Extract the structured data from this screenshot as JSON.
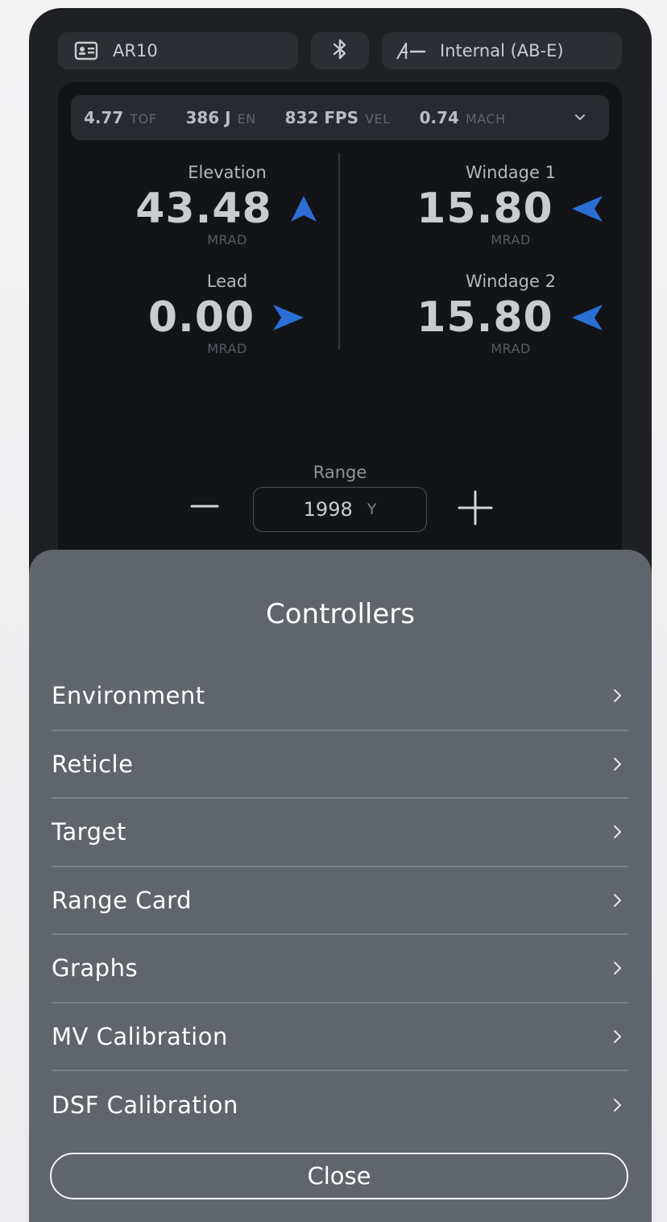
{
  "header": {
    "profile_name": "AR10",
    "source_label": "Internal (AB-E)"
  },
  "stats": [
    {
      "value": "4.77",
      "unit": "TOF"
    },
    {
      "value": "386 J",
      "unit": "EN"
    },
    {
      "value": "832 FPS",
      "unit": "VEL"
    },
    {
      "value": "0.74",
      "unit": "MACH"
    }
  ],
  "solution": {
    "elevation": {
      "label": "Elevation",
      "value": "43.48",
      "unit": "MRAD",
      "direction": "up"
    },
    "windage1": {
      "label": "Windage 1",
      "value": "15.80",
      "unit": "MRAD",
      "direction": "left"
    },
    "lead": {
      "label": "Lead",
      "value": "0.00",
      "unit": "MRAD",
      "direction": "right"
    },
    "windage2": {
      "label": "Windage 2",
      "value": "15.80",
      "unit": "MRAD",
      "direction": "left"
    }
  },
  "range": {
    "label": "Range",
    "value": "1998",
    "unit": "Y"
  },
  "sheet": {
    "title": "Controllers",
    "items": [
      {
        "label": "Environment"
      },
      {
        "label": "Reticle"
      },
      {
        "label": "Target"
      },
      {
        "label": "Range Card"
      },
      {
        "label": "Graphs"
      },
      {
        "label": "MV Calibration"
      },
      {
        "label": "DSF Calibration"
      }
    ],
    "close_label": "Close"
  },
  "colors": {
    "accent_arrow": "#2b6fd6",
    "sheet_bg": "#60646b",
    "panel_bg": "#121418"
  },
  "icons": {
    "profile": "id-card-icon",
    "bluetooth": "bluetooth-icon",
    "source": "ab-logo-icon",
    "expand": "chevron-down-icon",
    "row": "chevron-right-icon"
  }
}
